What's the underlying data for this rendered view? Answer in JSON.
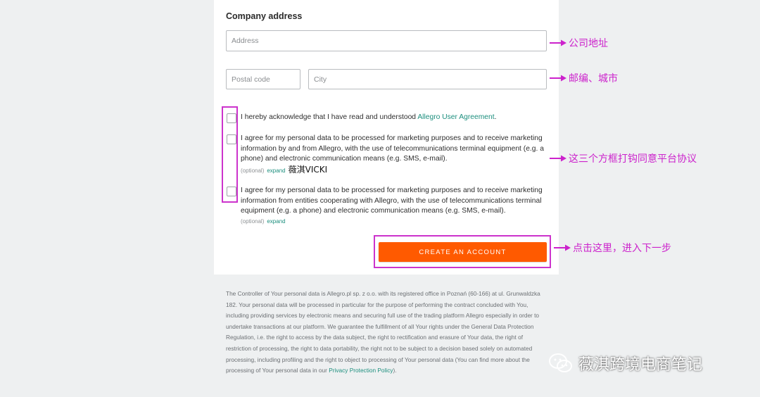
{
  "form": {
    "section_title": "Company address",
    "address_placeholder": "Address",
    "postal_placeholder": "Postal code",
    "city_placeholder": "City",
    "consent1": {
      "text": "I hereby acknowledge that I have read and understood ",
      "link": "Allegro User Agreement",
      "suffix": "."
    },
    "consent2": {
      "text": "I agree for my personal data to be processed for marketing purposes and to receive marketing information by and from Allegro, with the use of telecommunications terminal equipment (e.g. a phone) and electronic communication means (e.g. SMS, e-mail).",
      "optional": "(optional)",
      "expand": "expand"
    },
    "consent3": {
      "text": "I agree for my personal data to be processed for marketing purposes and to receive marketing information from entities cooperating with Allegro, with the use of telecommunications terminal equipment (e.g. a phone) and electronic communication means (e.g. SMS, e-mail).",
      "optional": "(optional)",
      "expand": "expand"
    },
    "submit_label": "CREATE AN ACCOUNT"
  },
  "annotations": {
    "address": "公司地址",
    "postal_city": "邮编、城市",
    "checkboxes": "这三个方框打钩同意平台协议",
    "button": "点击这里，进入下一步",
    "inline_watermark": "薇淇VICKI"
  },
  "legal": {
    "text": "The Controller of Your personal data is Allegro.pl sp. z o.o. with its registered office in Poznań (60-166) at ul. Grunwaldzka 182. Your personal data will be processed in particular for the purpose of performing the contract concluded with You, including providing services by electronic means and securing full use of the trading platform Allegro especially in order to undertake transactions at our platform. We guarantee the fulfillment of all Your rights under the General Data Protection Regulation, i.e. the right to access by the data subject, the right to rectification and erasure of Your data, the right of restriction of processing, the right to data portability, the right not to be subject to a decision based solely on automated processing, including profiling and the right to object to processing of Your personal data (You can find more about the processing of Your personal data in our ",
    "link": "Privacy Protection Policy",
    "suffix": ")."
  },
  "watermark": {
    "text": "薇淇跨境电商笔记",
    "icon": "wechat-icon"
  },
  "colors": {
    "accent": "#ff5a00",
    "link": "#1d8f7e",
    "annotation": "#cc33cc"
  }
}
